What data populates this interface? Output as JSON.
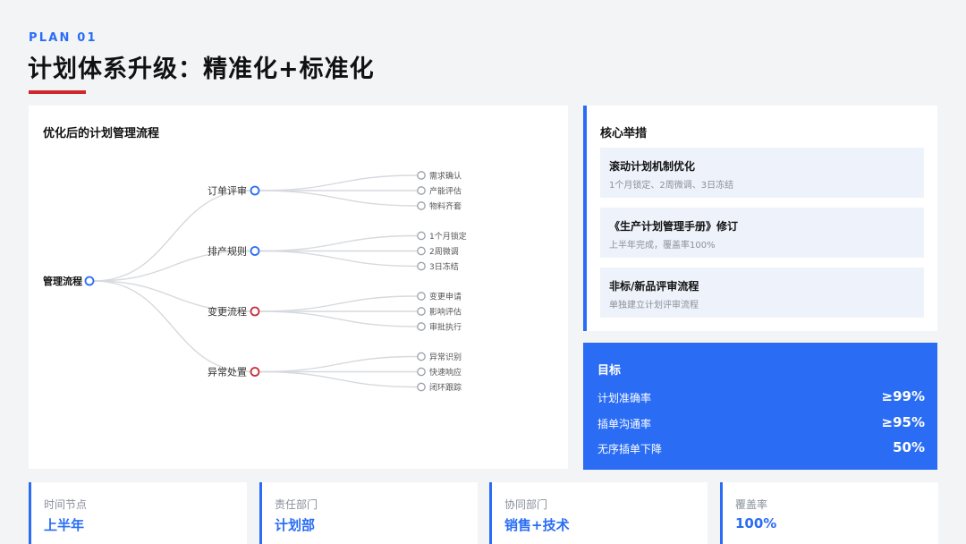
{
  "header": {
    "plan_label": "PLAN 01",
    "title": "计划体系升级：精准化+标准化"
  },
  "flow": {
    "title": "优化后的计划管理流程",
    "root": "管理流程",
    "branches": [
      {
        "label": "订单评审",
        "accent": "#2a6df4",
        "children": [
          "需求确认",
          "产能评估",
          "物料齐套"
        ]
      },
      {
        "label": "排产规则",
        "accent": "#2a6df4",
        "children": [
          "1个月锁定",
          "2周微调",
          "3日冻结"
        ]
      },
      {
        "label": "变更流程",
        "accent": "#c62f3a",
        "children": [
          "变更申请",
          "影响评估",
          "审批执行"
        ]
      },
      {
        "label": "异常处置",
        "accent": "#c62f3a",
        "children": [
          "异常识别",
          "快速响应",
          "闭环跟踪"
        ]
      }
    ]
  },
  "measures": {
    "title": "核心举措",
    "items": [
      {
        "title": "滚动计划机制优化",
        "desc": "1个月锁定、2周微调、3日冻结"
      },
      {
        "title": "《生产计划管理手册》修订",
        "desc": "上半年完成，覆盖率100%"
      },
      {
        "title": "非标/新品评审流程",
        "desc": "单独建立计划评审流程"
      }
    ]
  },
  "goals": {
    "title": "目标",
    "rows": [
      {
        "label": "计划准确率",
        "value": "≥99%"
      },
      {
        "label": "插单沟通率",
        "value": "≥95%"
      },
      {
        "label": "无序插单下降",
        "value": "50%"
      }
    ]
  },
  "stats": [
    {
      "label": "时间节点",
      "value": "上半年"
    },
    {
      "label": "责任部门",
      "value": "计划部"
    },
    {
      "label": "协同部门",
      "value": "销售+技术"
    },
    {
      "label": "覆盖率",
      "value": "100%"
    }
  ],
  "colors": {
    "accent_blue": "#2a6df4",
    "accent_red": "#d0262f"
  }
}
